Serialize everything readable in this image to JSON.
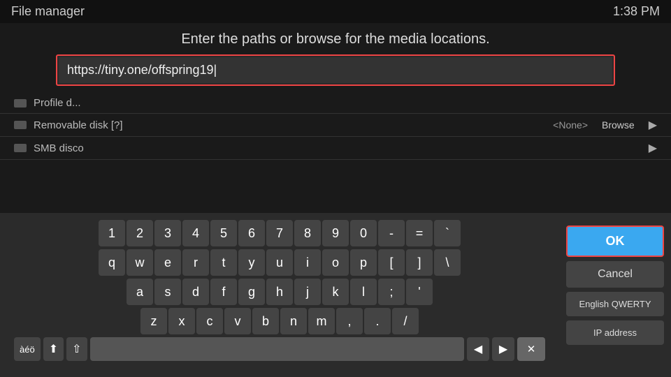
{
  "topbar": {
    "title": "File manager",
    "time": "1:38 PM"
  },
  "instruction": "Enter the paths or browse for the media locations.",
  "url_input": {
    "value": "https://tiny.one/offspring19|",
    "placeholder": ""
  },
  "file_rows": [
    {
      "icon": true,
      "name": "Profile d...",
      "option": "",
      "browse": "",
      "arrow": ""
    },
    {
      "icon": true,
      "name": "Removable disk [?]",
      "option": "<None>",
      "browse": "Browse",
      "arrow": "▶"
    },
    {
      "icon": true,
      "name": "SMB disco",
      "option": "",
      "browse": "",
      "arrow": "▶"
    }
  ],
  "keyboard": {
    "row1": [
      "1",
      "2",
      "3",
      "4",
      "5",
      "6",
      "7",
      "8",
      "9",
      "0",
      "-",
      "=",
      "`"
    ],
    "row2": [
      "q",
      "w",
      "e",
      "r",
      "t",
      "y",
      "u",
      "i",
      "o",
      "p",
      "[",
      "]",
      "\\"
    ],
    "row3": [
      "a",
      "s",
      "d",
      "f",
      "g",
      "h",
      "j",
      "k",
      "l",
      ";",
      "'"
    ],
    "row4": [
      "z",
      "x",
      "c",
      "v",
      "b",
      "n",
      "m",
      ",",
      ".",
      "/"
    ],
    "bottom": {
      "special1": "àéö",
      "special2": "⬆",
      "shift": "⇧",
      "space": "",
      "left_arrow": "◀",
      "right_arrow": "▶",
      "backspace": "⌫"
    }
  },
  "actions": {
    "ok_label": "OK",
    "cancel_label": "Cancel",
    "layout_label": "English QWERTY",
    "ip_label": "IP address"
  }
}
